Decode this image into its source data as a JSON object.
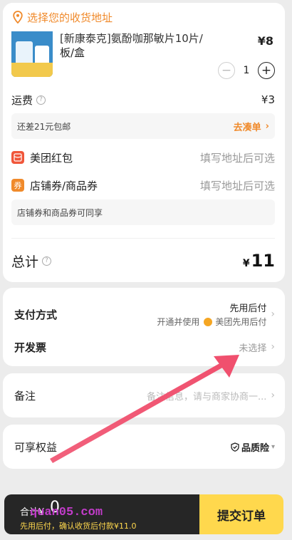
{
  "address": {
    "prompt": "选择您的收货地址"
  },
  "product": {
    "title_line1": "[新康泰克]氨酚咖那敏片10片/",
    "title_line2": "板/盒",
    "price": "¥8",
    "quantity": "1",
    "minus": "−",
    "plus": "+"
  },
  "shipping": {
    "label": "运费",
    "value": "¥3"
  },
  "free_shipping": {
    "text": "还差21元包邮",
    "link": "去凑单"
  },
  "red_packet": {
    "icon_text": "",
    "label": "美团红包",
    "value": "填写地址后可选"
  },
  "coupon": {
    "icon_text": "券",
    "label": "店铺券/商品券",
    "value": "填写地址后可选",
    "note": "店铺券和商品券可同享"
  },
  "total": {
    "label": "总计",
    "currency": "¥",
    "amount": "11"
  },
  "payment": {
    "label": "支付方式",
    "value_line1": "先用后付",
    "value_line2_prefix": "开通并使用",
    "value_line2_brand": "美团先用后付"
  },
  "invoice": {
    "label": "开发票",
    "value": "未选择"
  },
  "remark": {
    "label": "备注",
    "placeholder": "备注信息，请与商家协商一..."
  },
  "benefits": {
    "label": "可享权益",
    "value": "品质险"
  },
  "footer": {
    "total_prefix": "合计¥",
    "total_value": "0",
    "watermark": "quan05.com",
    "note": "先用后付，确认收货后付款¥11.0",
    "submit": "提交订单"
  },
  "colors": {
    "accent": "#f08a2b",
    "submit_bg": "#ffd84d",
    "arrow": "#f0506e"
  }
}
